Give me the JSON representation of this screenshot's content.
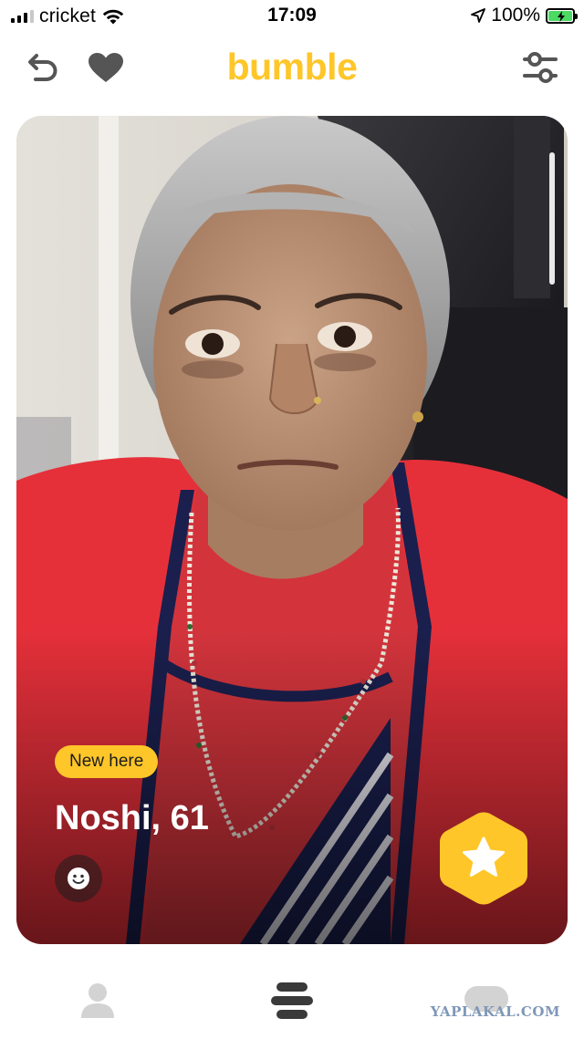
{
  "status_bar": {
    "carrier": "cricket",
    "time": "17:09",
    "battery_percent": "100%"
  },
  "header": {
    "logo_text": "bumble",
    "back_icon": "undo-arrow-icon",
    "like_icon": "heart-icon",
    "filter_icon": "sliders-icon"
  },
  "profile_card": {
    "badge": "New here",
    "name_age": "Noshi, 61",
    "photo_index_fraction": 0.2,
    "info_icon": "smiley-icon",
    "superswipe_icon": "star-hexagon-icon"
  },
  "bottom_nav": {
    "items": [
      {
        "icon": "person-icon",
        "active": false
      },
      {
        "icon": "stack-cards-icon",
        "active": true
      },
      {
        "icon": "chat-bubble-icon",
        "active": false
      }
    ]
  },
  "watermark": "YAPLAKAL.COM",
  "colors": {
    "brand_yellow": "#ffc629",
    "jacket_red": "#e5303a",
    "nav_inactive": "#d3d3d3",
    "nav_active": "#3a3a3a"
  }
}
